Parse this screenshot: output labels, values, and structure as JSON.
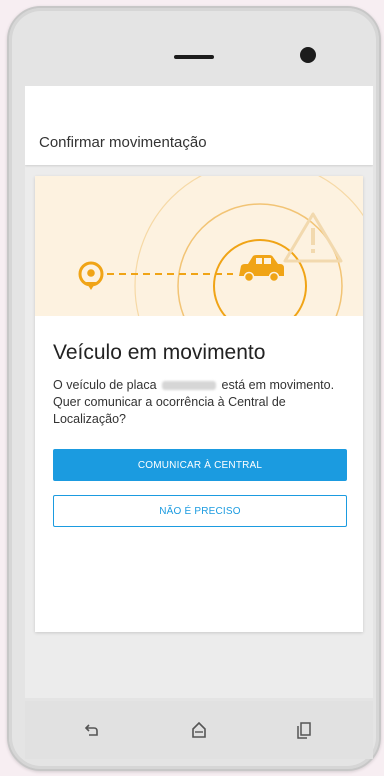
{
  "appbar": {
    "title": "Confirmar movimentação"
  },
  "card": {
    "title": "Veículo em movimento",
    "message_before_plate": "O veículo de placa",
    "message_after_plate": "está em movimento. Quer comunicar a ocorrência à Central de Localização?",
    "primary_button": "COMUNICAR À CENTRAL",
    "secondary_button": "NÃO É PRECISO"
  },
  "navbar": {
    "buttons": [
      "back-icon",
      "home-icon",
      "recent-apps-icon"
    ]
  },
  "colors": {
    "accent": "#1b9be0",
    "illustration_bg": "#fdf2e0",
    "illustration_orange": "#f0a416"
  }
}
